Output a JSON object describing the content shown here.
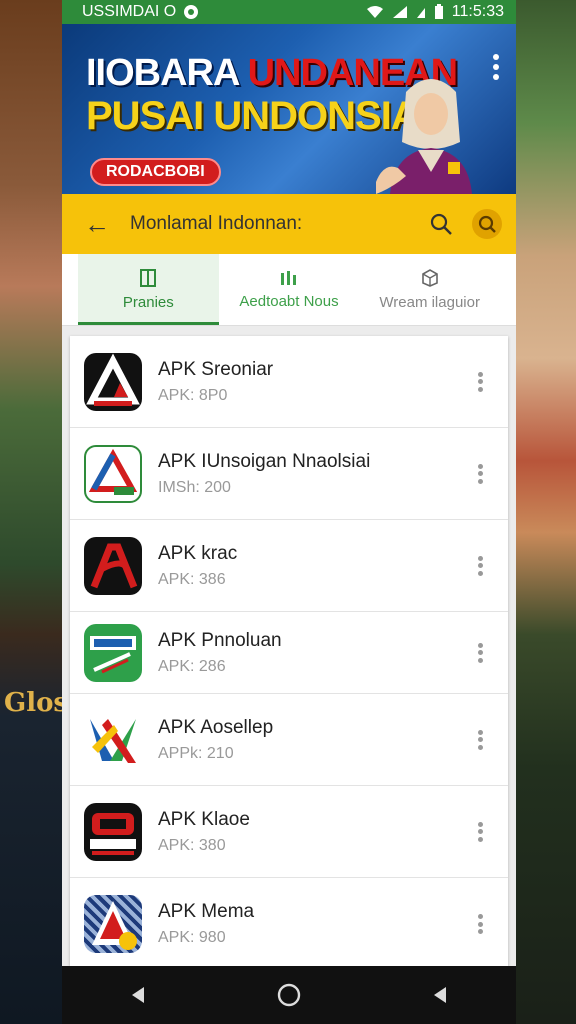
{
  "status_bar": {
    "carrier": "USSIMDAI O",
    "time": "11:5:33"
  },
  "banner": {
    "line1_white": "IIOBARA",
    "line1_red": "UNDANEAN",
    "line2": "PUSAI UNDONSIA!",
    "pill": "RODACBOBI"
  },
  "appbar": {
    "title": "Monlamal Indonnan:"
  },
  "tabs": [
    {
      "label": "Pranies"
    },
    {
      "label": "Aedtoabt Nous"
    },
    {
      "label": "Wream ilaguior"
    }
  ],
  "apps": [
    {
      "title": "APK Sreoniar",
      "sub": "APK: 8P0",
      "icon": "a-triangle-black-icon"
    },
    {
      "title": "APK IUnsoigan Nnaolsiai",
      "sub": "IMSh: 200",
      "icon": "a-triangle-color-icon"
    },
    {
      "title": "APK krac",
      "sub": "APK: 386",
      "icon": "ap-logo-black-icon"
    },
    {
      "title": "APK Pnnoluan",
      "sub": "APK: 286",
      "icon": "app-green-icon"
    },
    {
      "title": "APK Aosellep",
      "sub": "APPk: 210",
      "icon": "x-color-icon"
    },
    {
      "title": "APK Klaoe",
      "sub": "APK: 380",
      "icon": "kora-red-icon"
    },
    {
      "title": "APK Mema",
      "sub": "APK: 980",
      "icon": "a-pattern-icon"
    }
  ],
  "colors": {
    "status_green": "#2e8b3a",
    "appbar_yellow": "#f6c20a",
    "banner_blue": "#1d5fb0",
    "pill_red": "#d21d1d"
  },
  "backdrop": {
    "left_text": "Glos"
  }
}
